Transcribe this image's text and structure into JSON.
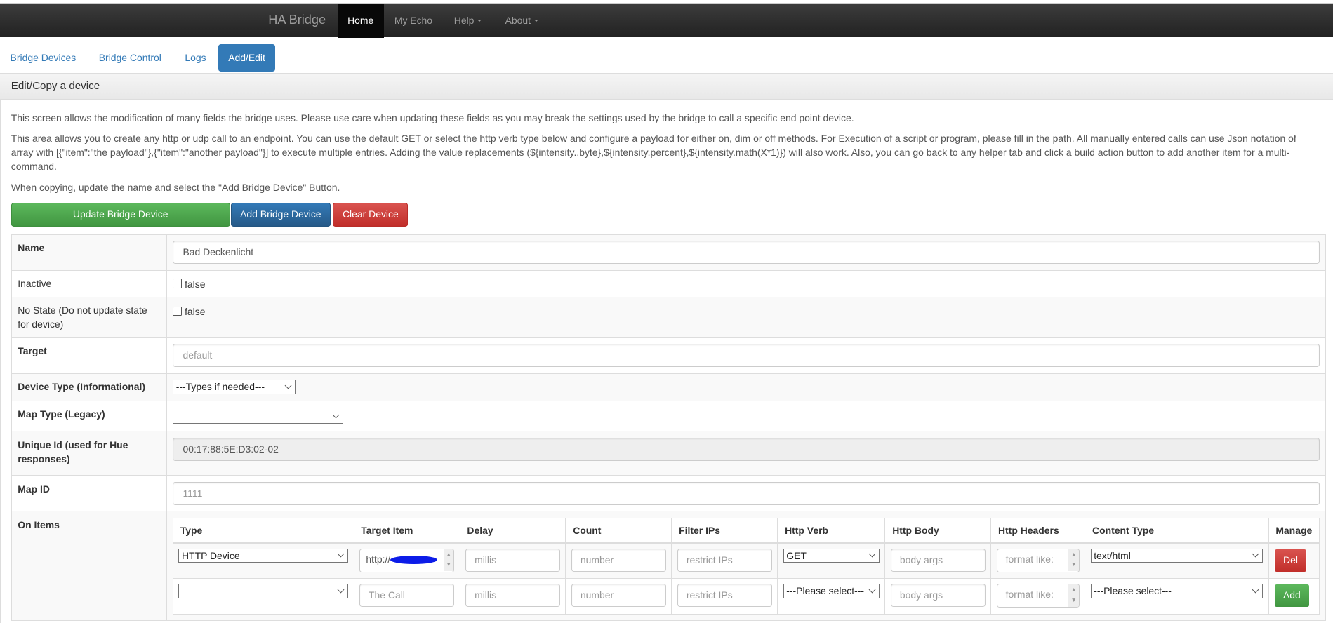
{
  "navbar": {
    "brand": "HA Bridge",
    "items": [
      {
        "label": "Home",
        "active": true
      },
      {
        "label": "My Echo"
      },
      {
        "label": "Help"
      },
      {
        "label": "About"
      }
    ]
  },
  "tabs": [
    {
      "label": "Bridge Devices"
    },
    {
      "label": "Bridge Control"
    },
    {
      "label": "Logs"
    },
    {
      "label": "Add/Edit",
      "active": true
    }
  ],
  "panel": {
    "title": "Edit/Copy a device",
    "paragraphs": [
      "This screen allows the modification of many fields the bridge uses. Please use care when updating these fields as you may break the settings used by the bridge to call a specific end point device.",
      "This area allows you to create any http or udp call to an endpoint. You can use the default GET or select the http verb type below and configure a payload for either on, dim or off methods. For Execution of a script or program, please fill in the path. All manually entered calls can use Json notation of array with [{\"item\":\"the payload\"},{\"item\":\"another payload\"}] to execute multiple entries. Adding the value replacements (${intensity..byte},${intensity.percent},${intensity.math(X*1)}) will also work. Also, you can go back to any helper tab and click a build action button to add another item for a multi-command.",
      "When copying, update the name and select the \"Add Bridge Device\" Button."
    ],
    "buttons": {
      "update": "Update Bridge Device",
      "add": "Add Bridge Device",
      "clear": "Clear Device"
    }
  },
  "form": {
    "name": {
      "label": "Name",
      "value": "Bad Deckenlicht"
    },
    "inactive": {
      "label": "Inactive",
      "value": "false"
    },
    "nostate": {
      "label": "No State (Do not update state for device)",
      "value": "false"
    },
    "target": {
      "label": "Target",
      "placeholder": "default"
    },
    "devicetype": {
      "label": "Device Type (Informational)",
      "value": "---Types if needed---"
    },
    "maptype": {
      "label": "Map Type (Legacy)",
      "value": ""
    },
    "uniqueid": {
      "label": "Unique Id (used for Hue responses)",
      "value": "00:17:88:5E:D3:02-02"
    },
    "mapid": {
      "label": "Map ID",
      "placeholder": "1111"
    },
    "onitems": {
      "label": "On Items",
      "columns": [
        "Type",
        "Target Item",
        "Delay",
        "Count",
        "Filter IPs",
        "Http Verb",
        "Http Body",
        "Http Headers",
        "Content Type",
        "Manage"
      ],
      "rows": [
        {
          "type": "HTTP Device",
          "target": "http://",
          "delay": "millis",
          "count": "number",
          "filter": "restrict IPs",
          "verb": "GET",
          "body": "body args",
          "headers": "format like:",
          "content": "text/html",
          "action": "Del"
        },
        {
          "type": "",
          "target": "The Call",
          "delay": "millis",
          "count": "number",
          "filter": "restrict IPs",
          "verb": "---Please select---",
          "body": "body args",
          "headers": "format like:",
          "content": "---Please select---",
          "action": "Add"
        }
      ]
    }
  }
}
